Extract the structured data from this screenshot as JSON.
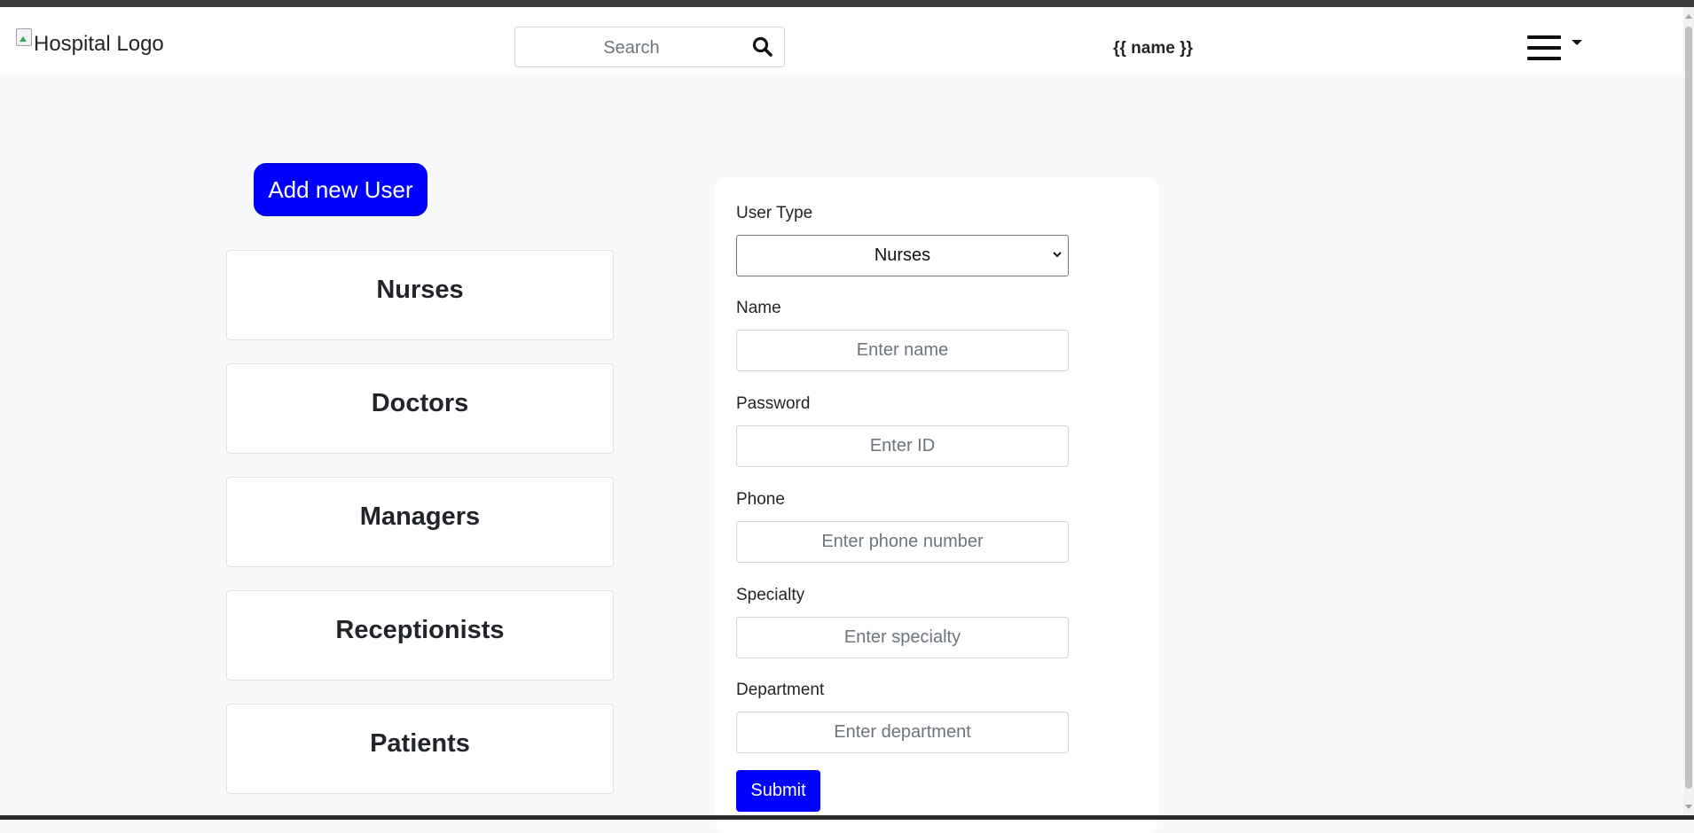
{
  "header": {
    "logo_alt": "Hospital Logo",
    "search_placeholder": "Search",
    "search_icon": "search-icon",
    "username": "{{ name }}",
    "menu_icon": "hamburger-menu-icon"
  },
  "sidebar": {
    "add_user_label": "Add new User",
    "categories": [
      {
        "label": "Nurses"
      },
      {
        "label": "Doctors"
      },
      {
        "label": "Managers"
      },
      {
        "label": "Receptionists"
      },
      {
        "label": "Patients"
      }
    ]
  },
  "form": {
    "user_type": {
      "label": "User Type",
      "selected": "Nurses"
    },
    "name": {
      "label": "Name",
      "placeholder": "Enter name"
    },
    "password": {
      "label": "Password",
      "placeholder": "Enter ID"
    },
    "phone": {
      "label": "Phone",
      "placeholder": "Enter phone number"
    },
    "specialty": {
      "label": "Specialty",
      "placeholder": "Enter specialty"
    },
    "department": {
      "label": "Department",
      "placeholder": "Enter department"
    },
    "submit_label": "Submit"
  },
  "colors": {
    "primary": "#0000ff",
    "page_bg": "#f8f9fa",
    "card_bg": "#ffffff"
  }
}
